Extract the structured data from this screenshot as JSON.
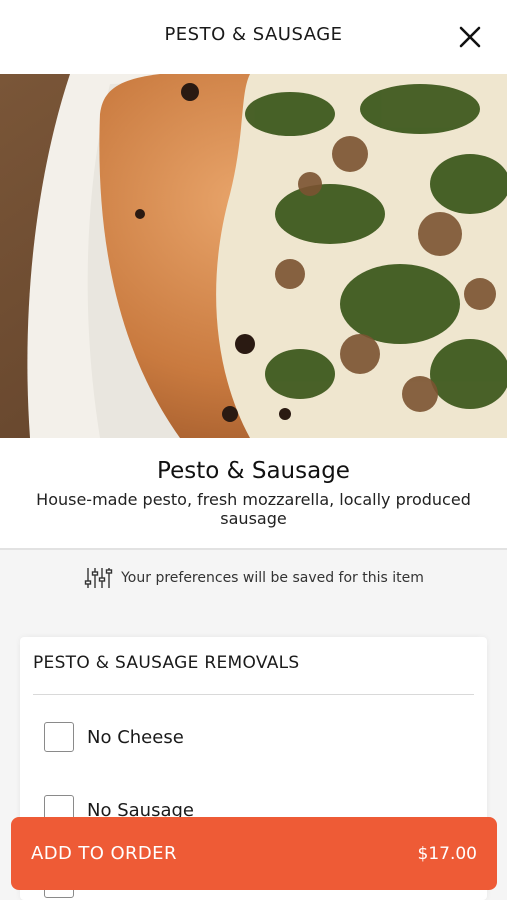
{
  "header": {
    "title": "PESTO & SAUSAGE",
    "close_icon": "close-icon"
  },
  "item": {
    "name": "Pesto & Sausage",
    "description": "House-made pesto, fresh mozzarella, locally produced sausage",
    "image": "pizza-photo"
  },
  "preferences": {
    "icon": "sliders-icon",
    "text": "Your preferences will be saved for this item"
  },
  "removals": {
    "header": "PESTO & SAUSAGE REMOVALS",
    "options": [
      {
        "label": "No Cheese",
        "checked": false
      },
      {
        "label": "No Sausage",
        "checked": false
      },
      {
        "label": "",
        "checked": false
      }
    ]
  },
  "order_button": {
    "label": "ADD TO ORDER",
    "price": "$17.00",
    "color": "#ee5b36"
  }
}
